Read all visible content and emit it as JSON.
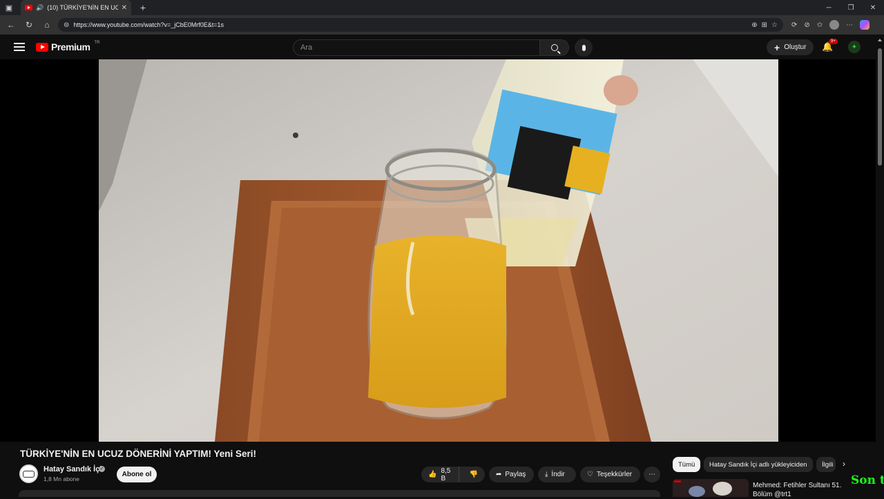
{
  "browser": {
    "tab_title": "(10) TÜRKİYE'NİN EN UCUZ",
    "url": "https://www.youtube.com/watch?v=_jCbE0Mrf0E&t=1s",
    "new_tab": "+",
    "minimize": "─",
    "restore": "❐",
    "close": "✕"
  },
  "youtube": {
    "logo_text": "Premium",
    "country": "TR",
    "search_placeholder": "Ara",
    "create_label": "Oluştur",
    "notifications_badge": "9+"
  },
  "video": {
    "title": "TÜRKİYE'NİN EN UCUZ DÖNERİNİ YAPTIM! Yeni Seri!",
    "channel": "Hatay Sandık İçi",
    "subscribers": "1,8 Mn abone",
    "subscribe_label": "Abone ol",
    "likes": "8,5 B",
    "share_label": "Paylaş",
    "download_label": "İndir",
    "thanks_label": "Teşekkürler",
    "more_label": "⋯"
  },
  "sidebar": {
    "chips": [
      "Tümü",
      "Hatay Sandık İçi adlı yükleyiciden",
      "İlgili"
    ],
    "rec_title": "Mehmed: Fetihler Sultanı 51. Bölüm @trt1"
  },
  "overlay_text": "Son t",
  "colors": {
    "bg": "#0f0f0f",
    "brand_red": "#ff0000",
    "chip_bg": "#272727",
    "overlay_green": "#1aff1a"
  }
}
